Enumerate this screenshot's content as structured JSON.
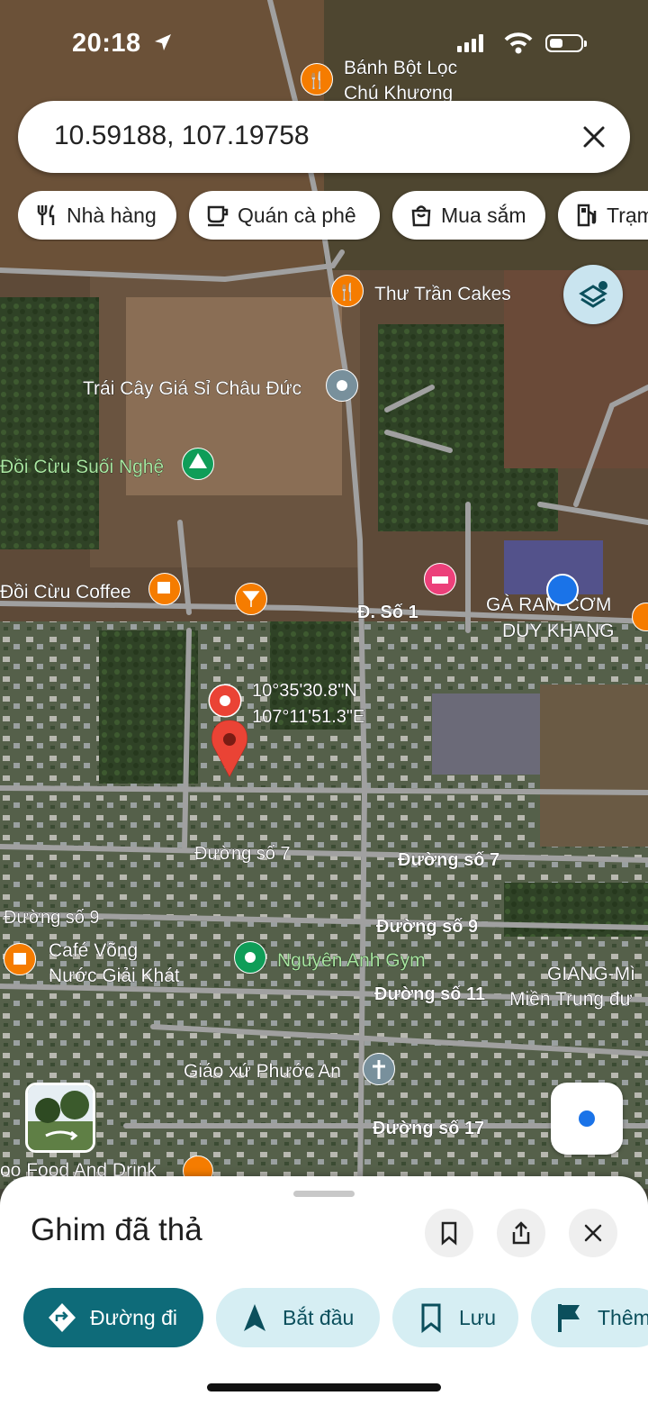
{
  "status": {
    "time": "20:18"
  },
  "search": {
    "query": "10.59188, 107.19758"
  },
  "chips": [
    {
      "label": "Nhà hàng",
      "icon": "fork-knife-icon"
    },
    {
      "label": "Quán cà phê",
      "icon": "coffee-cup-icon"
    },
    {
      "label": "Mua sắm",
      "icon": "shopping-bag-icon"
    },
    {
      "label": "Trạm",
      "icon": "gas-station-icon"
    }
  ],
  "map": {
    "places": [
      {
        "line1": "Bánh Bột Lọc",
        "line2": "Chú Khương",
        "icon": "restaurant-icon",
        "color": "#f57c00"
      },
      {
        "line1": "Thư Trần Cakes",
        "icon": "restaurant-icon",
        "color": "#f57c00"
      },
      {
        "line1": "Trái Cây Giá Sỉ Châu Đức",
        "icon": "place-icon",
        "color": "#78909c"
      },
      {
        "line1": "Đồi Cừu Suối Nghệ",
        "icon": "park-icon",
        "color": "#0f9d58",
        "text_color": "#a8e6a0"
      },
      {
        "line1": "Đồi Cừu Coffee",
        "icon": "coffee-icon",
        "color": "#f57c00"
      },
      {
        "line1": "",
        "icon": "bar-icon",
        "color": "#f57c00"
      },
      {
        "line1": "",
        "icon": "hotel-icon",
        "color": "#ec407a"
      },
      {
        "line1": "GÀ RAM CƠM",
        "line2": "DUY KHANG",
        "icon": "restaurant-icon",
        "color": "#f57c00"
      },
      {
        "line1": "Café Võng",
        "line2": "Nước Giải Khát",
        "icon": "coffee-icon",
        "color": "#f57c00"
      },
      {
        "line1": "Nguyên Anh Gym",
        "icon": "gym-icon",
        "color": "#0f9d58",
        "text_color": "#a8e6a0"
      },
      {
        "line1": "GIANG-Mì",
        "line2": "Miền Trung đư",
        "icon": "",
        "color": "#f57c00"
      },
      {
        "line1": "Giáo xứ Phước An",
        "icon": "church-icon",
        "color": "#78909c"
      },
      {
        "line1": "oo Food And Drink",
        "icon": "restaurant-icon",
        "color": "#f57c00"
      }
    ],
    "roads": [
      "Đ. Số 1",
      "Đường số 7",
      "Đường số 7",
      "Đường số 9",
      "Đường số 9",
      "Đường số 11",
      "Đường số 17"
    ],
    "pin": {
      "lat": "10°35'30.8\"N",
      "lon": "107°11'51.3\"E",
      "color": "#ea4335"
    }
  },
  "sheet": {
    "title": "Ghim đã thả",
    "actions": [
      {
        "label": "Đường đi",
        "icon": "directions-icon"
      },
      {
        "label": "Bắt đầu",
        "icon": "navigation-arrow-icon"
      },
      {
        "label": "Lưu",
        "icon": "bookmark-icon"
      },
      {
        "label": "Thêm",
        "icon": "flag-icon"
      }
    ]
  },
  "colors": {
    "accent": "#0e6b79",
    "accent_light": "#d6eef3",
    "location_blue": "#1a73e8"
  }
}
